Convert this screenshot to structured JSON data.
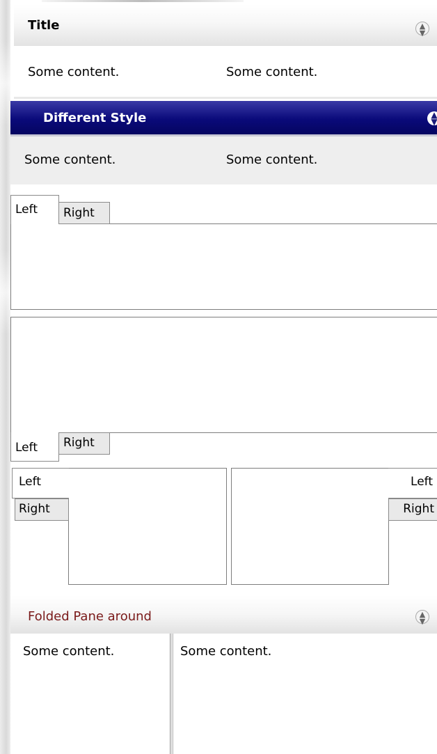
{
  "pane_title": {
    "title": "Title",
    "content": [
      "Some content.",
      "Some content."
    ]
  },
  "pane_different": {
    "title": "Different Style",
    "content": [
      "Some content.",
      "Some content."
    ]
  },
  "tabs_top": {
    "left": "Left",
    "right": "Right"
  },
  "tabs_bottom": {
    "left": "Left",
    "right": "Right"
  },
  "tabs_leftside": {
    "left": "Left",
    "right": "Right"
  },
  "tabs_rightside": {
    "left": "Left",
    "right": "Right"
  },
  "pane_folded": {
    "title": "Folded Pane around",
    "content": [
      "Some content.",
      "Some content."
    ]
  },
  "icons": {
    "toggle": "collapse-toggle-icon"
  },
  "colors": {
    "different_header": "#0a0a7a",
    "folded_title": "#7a1a1a"
  }
}
